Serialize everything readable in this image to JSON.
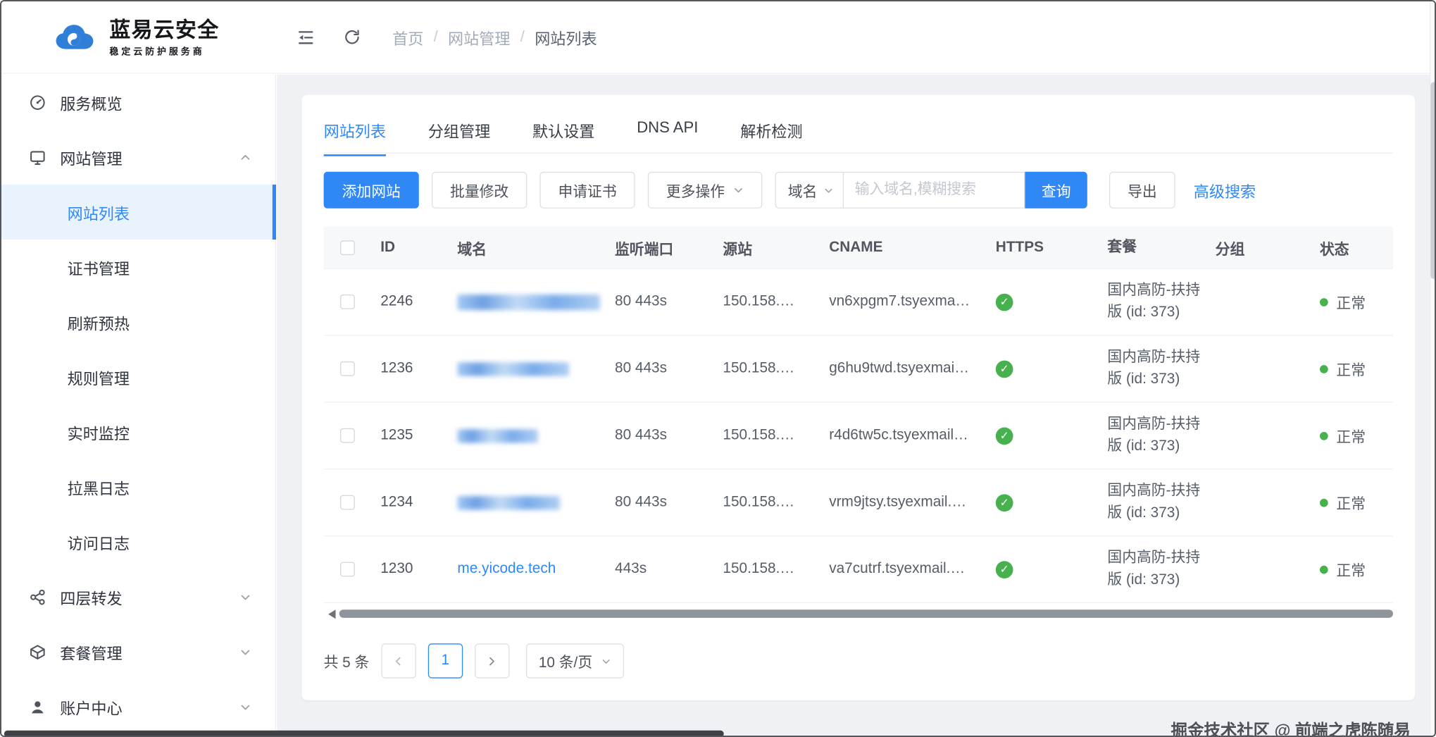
{
  "brand": {
    "name": "蓝易云安全",
    "tagline": "稳定云防护服务商"
  },
  "header": {
    "breadcrumb": [
      "首页",
      "网站管理",
      "网站列表"
    ]
  },
  "sidebar": {
    "items": [
      {
        "label": "服务概览"
      },
      {
        "label": "网站管理",
        "expanded": true,
        "children": [
          "网站列表",
          "证书管理",
          "刷新预热",
          "规则管理",
          "实时监控",
          "拉黑日志",
          "访问日志"
        ],
        "active_child": "网站列表"
      },
      {
        "label": "四层转发"
      },
      {
        "label": "套餐管理"
      },
      {
        "label": "账户中心"
      }
    ]
  },
  "tabs": {
    "items": [
      "网站列表",
      "分组管理",
      "默认设置",
      "DNS API",
      "解析检测"
    ],
    "active": "网站列表"
  },
  "toolbar": {
    "add_site": "添加网站",
    "batch_edit": "批量修改",
    "apply_cert": "申请证书",
    "more_actions": "更多操作",
    "domain_field": "域名",
    "search_placeholder": "输入域名,模糊搜索",
    "query": "查询",
    "export": "导出",
    "advanced_search": "高级搜索"
  },
  "table": {
    "columns": [
      "ID",
      "域名",
      "监听端口",
      "源站",
      "CNAME",
      "HTTPS",
      "套餐",
      "分组",
      "状态"
    ],
    "rows": [
      {
        "id": "2246",
        "domain": "",
        "redacted": true,
        "ports": "80 443s",
        "origin": "150.158.…",
        "cname": "vn6xpgm7.tsyexma…",
        "https": true,
        "plan": "国内高防-扶持版 (id: 373)",
        "group": "",
        "status": "正常"
      },
      {
        "id": "1236",
        "domain": "",
        "redacted": true,
        "ports": "80 443s",
        "origin": "150.158.…",
        "cname": "g6hu9twd.tsyexmai…",
        "https": true,
        "plan": "国内高防-扶持版 (id: 373)",
        "group": "",
        "status": "正常"
      },
      {
        "id": "1235",
        "domain": "",
        "redacted": true,
        "ports": "80 443s",
        "origin": "150.158.…",
        "cname": "r4d6tw5c.tsyexmail…",
        "https": true,
        "plan": "国内高防-扶持版 (id: 373)",
        "group": "",
        "status": "正常"
      },
      {
        "id": "1234",
        "domain": "",
        "redacted": true,
        "ports": "80 443s",
        "origin": "150.158.…",
        "cname": "vrm9jtsy.tsyexmail.…",
        "https": true,
        "plan": "国内高防-扶持版 (id: 373)",
        "group": "",
        "status": "正常"
      },
      {
        "id": "1230",
        "domain": "me.yicode.tech",
        "redacted": false,
        "ports": "443s",
        "origin": "150.158.…",
        "cname": "va7cutrf.tsyexmail.…",
        "https": true,
        "plan": "国内高防-扶持版 (id: 373)",
        "group": "",
        "status": "正常"
      }
    ]
  },
  "pagination": {
    "total": "共 5 条",
    "current_page": "1",
    "page_size": "10 条/页"
  },
  "watermark": "掘金技术社区 @ 前端之虎陈随易",
  "colors": {
    "primary": "#2F88F6",
    "success": "#47B14E"
  }
}
